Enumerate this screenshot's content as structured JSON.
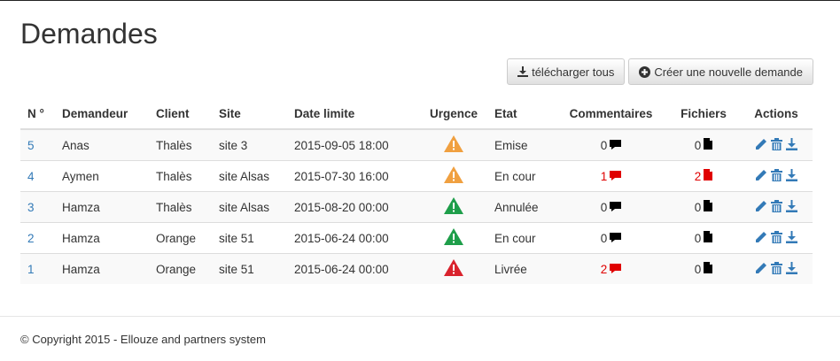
{
  "page": {
    "title": "Demandes"
  },
  "toolbar": {
    "download_all_label": "télécharger tous",
    "new_request_label": "Créer une nouvelle demande"
  },
  "table": {
    "headers": {
      "num": "N °",
      "requester": "Demandeur",
      "client": "Client",
      "site": "Site",
      "deadline": "Date limite",
      "urgency": "Urgence",
      "status": "Etat",
      "comments": "Commentaires",
      "files": "Fichiers",
      "actions": "Actions"
    },
    "rows": [
      {
        "num": "5",
        "requester": "Anas",
        "client": "Thalès",
        "site": "site 3",
        "deadline": "2015-09-05 18:00",
        "urgency_color": "#f0a040",
        "status": "Emise",
        "comments": "0",
        "comments_highlight": false,
        "files": "0",
        "files_highlight": false
      },
      {
        "num": "4",
        "requester": "Aymen",
        "client": "Thalès",
        "site": "site Alsas",
        "deadline": "2015-07-30 16:00",
        "urgency_color": "#f0a040",
        "status": "En cour",
        "comments": "1",
        "comments_highlight": true,
        "files": "2",
        "files_highlight": true
      },
      {
        "num": "3",
        "requester": "Hamza",
        "client": "Thalès",
        "site": "site Alsas",
        "deadline": "2015-08-20 00:00",
        "urgency_color": "#1e9e4a",
        "status": "Annulée",
        "comments": "0",
        "comments_highlight": false,
        "files": "0",
        "files_highlight": false
      },
      {
        "num": "2",
        "requester": "Hamza",
        "client": "Orange",
        "site": "site 51",
        "deadline": "2015-06-24 00:00",
        "urgency_color": "#1e9e4a",
        "status": "En cour",
        "comments": "0",
        "comments_highlight": false,
        "files": "0",
        "files_highlight": false
      },
      {
        "num": "1",
        "requester": "Hamza",
        "client": "Orange",
        "site": "site 51",
        "deadline": "2015-06-24 00:00",
        "urgency_color": "#d9232d",
        "status": "Livrée",
        "comments": "2",
        "comments_highlight": true,
        "files": "0",
        "files_highlight": false
      }
    ]
  },
  "icons": {
    "urgency": "warning-triangle-icon",
    "comments": "comment-icon",
    "files": "file-icon",
    "edit": "pencil-icon",
    "delete": "trash-icon",
    "download": "download-icon",
    "download_all": "download-icon",
    "new_request": "plus-circle-icon"
  },
  "colors": {
    "link": "#337ab7",
    "highlight": "#e00000",
    "action_icons": "#337ab7"
  },
  "footer": {
    "copyright": "© Copyright 2015 - Ellouze and partners system"
  }
}
